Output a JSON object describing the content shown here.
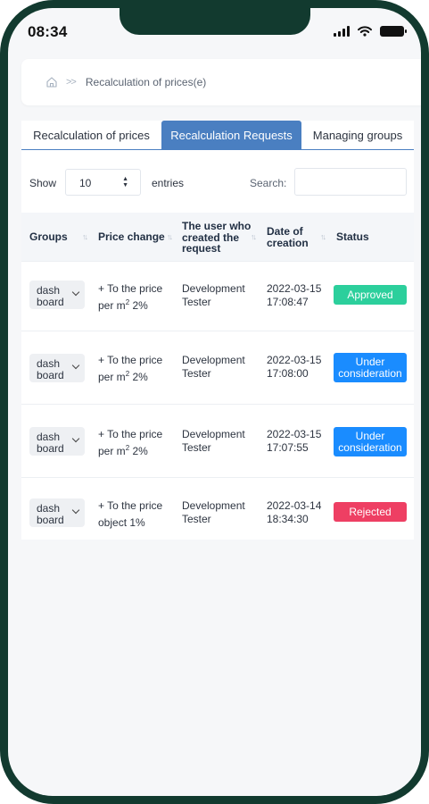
{
  "status_bar": {
    "time": "08:34"
  },
  "breadcrumb": {
    "separator": ">>",
    "current": "Recalculation of prices(e)"
  },
  "tabs": [
    {
      "label": "Recalculation of prices"
    },
    {
      "label": "Recalculation Requests"
    },
    {
      "label": "Managing groups"
    }
  ],
  "controls": {
    "show_label": "Show",
    "entries_value": "10",
    "entries_label": "entries",
    "search_label": "Search:",
    "search_value": ""
  },
  "table": {
    "headers": [
      "Groups",
      "Price change",
      "The user who created the request",
      "Date of creation",
      "Status"
    ],
    "rows": [
      {
        "group": "dash board",
        "price_change_prefix": "+ To the price per m",
        "price_change_sup": "2",
        "price_change_suffix": " 2%",
        "user": "Development Tester",
        "date": "2022-03-15",
        "time": "17:08:47",
        "status": "Approved"
      },
      {
        "group": "dash board",
        "price_change_prefix": "+ To the price per m",
        "price_change_sup": "2",
        "price_change_suffix": " 2%",
        "user": "Development Tester",
        "date": "2022-03-15",
        "time": "17:08:00",
        "status": "Under consideration"
      },
      {
        "group": "dash board",
        "price_change_prefix": "+ To the price per m",
        "price_change_sup": "2",
        "price_change_suffix": " 2%",
        "user": "Development Tester",
        "date": "2022-03-15",
        "time": "17:07:55",
        "status": "Under consideration"
      },
      {
        "group": "dash board",
        "price_change_prefix": "+ To the price object 1%",
        "price_change_sup": "",
        "price_change_suffix": "",
        "user": "Development Tester",
        "date": "2022-03-14",
        "time": "18:34:30",
        "status": "Rejected"
      }
    ]
  },
  "colors": {
    "approved": "#2ccf9c",
    "under_consideration": "#1a8cff",
    "rejected": "#ee3f63",
    "active_tab": "#4a7fc1",
    "phone_frame": "#123a2f"
  }
}
